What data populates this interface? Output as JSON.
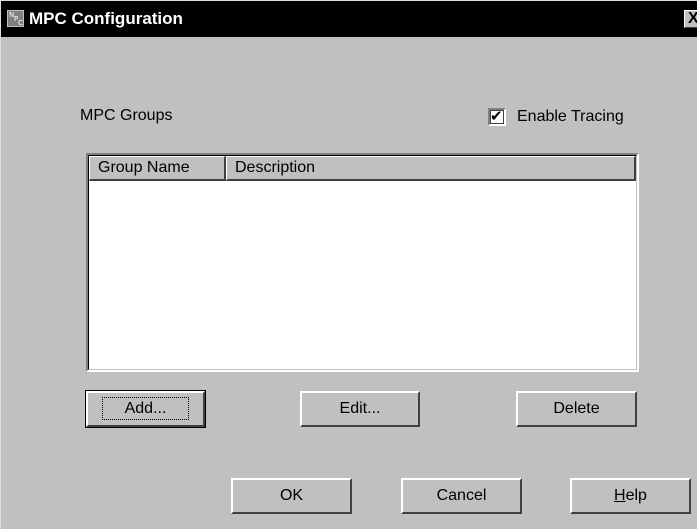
{
  "window": {
    "title": "MPC Configuration",
    "icon": "mpc-app-icon",
    "close_glyph": "X"
  },
  "groups_label": "MPC Groups",
  "tracing": {
    "label": "Enable Tracing",
    "checked": true,
    "check_glyph": "✔"
  },
  "list": {
    "columns": [
      "Group Name",
      "Description"
    ],
    "rows": []
  },
  "buttons": {
    "add": "Add...",
    "edit": "Edit...",
    "delete": "Delete",
    "ok": "OK",
    "cancel": "Cancel",
    "help_mnemonic": "H",
    "help_rest": "elp"
  }
}
